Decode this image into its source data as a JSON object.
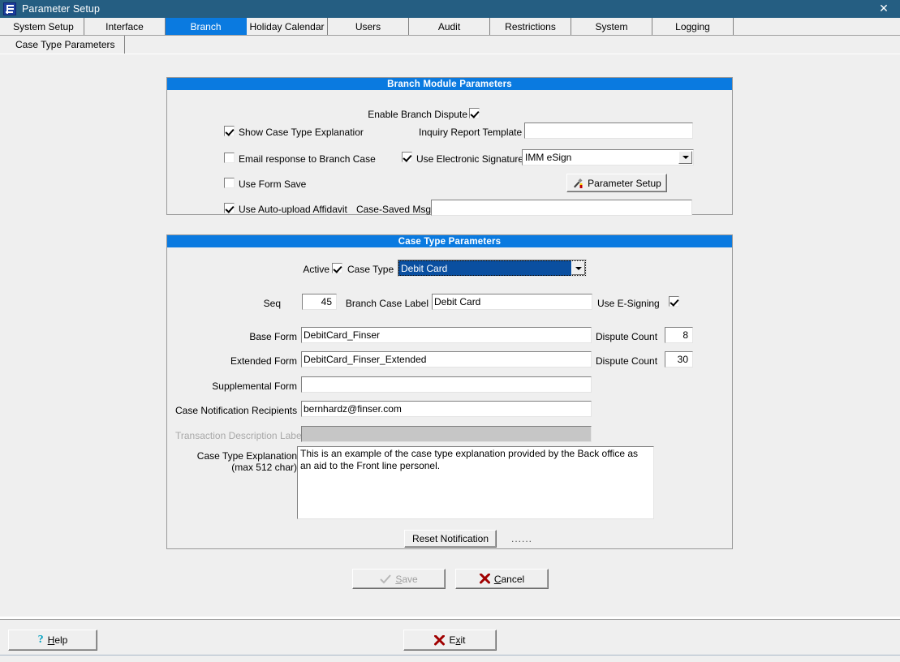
{
  "window": {
    "title": "Parameter Setup",
    "icon": "app-f-icon",
    "close_label": "✕"
  },
  "tabs": {
    "items": [
      {
        "label": "System Setup",
        "active": false
      },
      {
        "label": "Interface",
        "active": false
      },
      {
        "label": "Branch",
        "active": true
      },
      {
        "label": "Holiday Calendar",
        "active": false
      },
      {
        "label": "Users",
        "active": false
      },
      {
        "label": "Audit",
        "active": false
      },
      {
        "label": "Restrictions",
        "active": false
      },
      {
        "label": "System",
        "active": false
      },
      {
        "label": "Logging",
        "active": false
      }
    ]
  },
  "subtabs": {
    "items": [
      {
        "label": "Case Type Parameters",
        "active": true
      }
    ]
  },
  "branch_module": {
    "header": "Branch Module Parameters",
    "enable_branch_dispute": {
      "label": "Enable Branch Dispute",
      "checked": true
    },
    "show_case_type_explanation": {
      "label": "Show Case Type Explanatior",
      "checked": true
    },
    "email_response_to_branch_case": {
      "label": "Email response to Branch Case",
      "checked": false
    },
    "use_form_save": {
      "label": "Use Form Save",
      "checked": false
    },
    "use_auto_upload_affidavit": {
      "label": "Use Auto-upload Affidavit",
      "checked": true
    },
    "inquiry_report_template": {
      "label": "Inquiry Report Template",
      "value": "",
      "placeholder": ""
    },
    "use_electronic_signature": {
      "label": "Use Electronic Signature",
      "checked": true
    },
    "esign_provider": {
      "value": "IMM eSign",
      "options": [
        "IMM eSign"
      ]
    },
    "parameter_setup_button": {
      "label": "Parameter Setup",
      "icon": "tools-icon"
    },
    "case_saved_msg": {
      "label": "Case-Saved Msg",
      "value": "",
      "placeholder": ""
    }
  },
  "case_type": {
    "header": "Case Type Parameters",
    "active": {
      "label": "Active",
      "checked": true
    },
    "case_type_combo": {
      "label": "Case Type",
      "value": "Debit Card",
      "options": [
        "Debit Card"
      ],
      "selected": true
    },
    "seq": {
      "label": "Seq",
      "value": "45"
    },
    "branch_case_label": {
      "label": "Branch Case Label",
      "value": "Debit Card"
    },
    "use_e_signing": {
      "label": "Use E-Signing",
      "checked": true
    },
    "base_form": {
      "label": "Base Form",
      "value": "DebitCard_Finser"
    },
    "base_dispute_count": {
      "label": "Dispute Count",
      "value": "8"
    },
    "extended_form": {
      "label": "Extended Form",
      "value": "DebitCard_Finser_Extended"
    },
    "extended_dispute_count": {
      "label": "Dispute Count",
      "value": "30"
    },
    "supplemental_form": {
      "label": "Supplemental Form",
      "value": ""
    },
    "case_notification_recipients": {
      "label": "Case Notification Recipients",
      "value": "bernhardz@finser.com"
    },
    "transaction_description_label": {
      "label": "Transaction Description Label",
      "value": "",
      "disabled": true
    },
    "case_type_explanation": {
      "label_line1": "Case Type Explanation",
      "label_line2": "(max 512 char)",
      "value": "This is an example of the case type explanation provided by the Back office as an aid to the Front line personel."
    },
    "reset_notification_button": {
      "label": "Reset Notification"
    },
    "dots": "......"
  },
  "actions": {
    "save": {
      "label": "Save",
      "accel": "S",
      "disabled": true,
      "icon": "check-icon"
    },
    "cancel": {
      "label": "Cancel",
      "accel": "C",
      "icon": "x-icon"
    }
  },
  "footer": {
    "help": {
      "label": "Help",
      "accel": "H",
      "icon": "question-icon"
    },
    "exit": {
      "label": "Exit",
      "accel": "x",
      "icon": "x-icon"
    }
  },
  "colors": {
    "titlebar": "#255E82",
    "panel_header": "#0A7AE0",
    "active_tab": "#0A7AE0",
    "face": "#EFEFEF",
    "combo_selection": "#0A4FA0",
    "red_x": "#A00000",
    "help_cyan": "#00A0C0"
  }
}
